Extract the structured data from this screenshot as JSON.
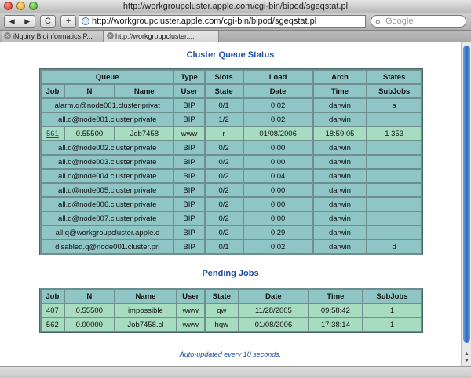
{
  "window": {
    "title": "http://workgroupcluster.apple.com/cgi-bin/bipod/sgeqstat.pl"
  },
  "toolbar": {
    "back_label": "◀",
    "forward_label": "▶",
    "reload_label": "C",
    "add_label": "+",
    "url": "http://workgroupcluster.apple.com/cgi-bin/bipod/sgeqstat.pl",
    "search_placeholder": "Google"
  },
  "tabs": [
    {
      "label": "iNquiry Bioinformatics P..."
    },
    {
      "label": "http://workgroupcluster...."
    }
  ],
  "queue_status": {
    "title": "Cluster Queue Status",
    "header_top": [
      "Queue",
      "Type",
      "Slots",
      "Load",
      "Arch",
      "States"
    ],
    "header_sub": [
      "Job",
      "N",
      "Name",
      "User",
      "State",
      "Date",
      "Time",
      "SubJobs"
    ],
    "rows": [
      {
        "kind": "queue",
        "cells": [
          "alarm.q@node001.cluster.privat",
          "BIP",
          "0/1",
          "0.02",
          "darwin",
          "a"
        ]
      },
      {
        "kind": "queue",
        "cells": [
          "all.q@node001.cluster.private",
          "BIP",
          "1/2",
          "0.02",
          "darwin",
          ""
        ]
      },
      {
        "kind": "job",
        "cells": [
          "561",
          "0.55500",
          "Job7458",
          "www",
          "r",
          "01/08/2006",
          "18:59:05",
          "1 353"
        ]
      },
      {
        "kind": "queue",
        "cells": [
          "all.q@node002.cluster.private",
          "BIP",
          "0/2",
          "0.00",
          "darwin",
          ""
        ]
      },
      {
        "kind": "queue",
        "cells": [
          "all.q@node003.cluster.private",
          "BIP",
          "0/2",
          "0.00",
          "darwin",
          ""
        ]
      },
      {
        "kind": "queue",
        "cells": [
          "all.q@node004.cluster.private",
          "BIP",
          "0/2",
          "0.04",
          "darwin",
          ""
        ]
      },
      {
        "kind": "queue",
        "cells": [
          "all.q@node005.cluster.private",
          "BIP",
          "0/2",
          "0.00",
          "darwin",
          ""
        ]
      },
      {
        "kind": "queue",
        "cells": [
          "all.q@node006.cluster.private",
          "BIP",
          "0/2",
          "0.00",
          "darwin",
          ""
        ]
      },
      {
        "kind": "queue",
        "cells": [
          "all.q@node007.cluster.private",
          "BIP",
          "0/2",
          "0.00",
          "darwin",
          ""
        ]
      },
      {
        "kind": "queue",
        "cells": [
          "all.q@workgroupcluster.apple.c",
          "BIP",
          "0/2",
          "0.29",
          "darwin",
          ""
        ]
      },
      {
        "kind": "queue",
        "cells": [
          "disabled.q@node001.cluster.pri",
          "BIP",
          "0/1",
          "0.02",
          "darwin",
          "d"
        ]
      }
    ]
  },
  "pending_jobs": {
    "title": "Pending Jobs",
    "headers": [
      "Job",
      "N",
      "Name",
      "User",
      "State",
      "Date",
      "Time",
      "SubJobs"
    ],
    "rows": [
      [
        "407",
        "0.55500",
        "impossible",
        "www",
        "qw",
        "11/28/2005",
        "09:58:42",
        "1"
      ],
      [
        "562",
        "0.00000",
        "Job7458.cl",
        "www",
        "hqw",
        "01/08/2006",
        "17:38:14",
        "1"
      ]
    ]
  },
  "footer": {
    "note": "Auto-updated every 10 seconds."
  }
}
